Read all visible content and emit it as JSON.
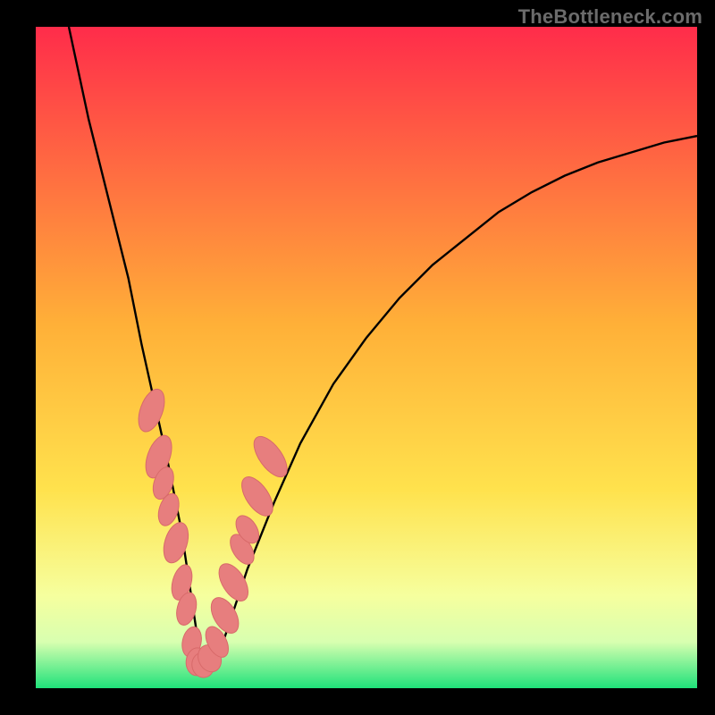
{
  "watermark": "TheBottleneck.com",
  "colors": {
    "frame": "#000000",
    "curve": "#000000",
    "marker_fill": "#e77e7e",
    "marker_stroke": "#d86a6a",
    "gradient_top": "#ff2c4a",
    "gradient_mid": "#ffd23a",
    "gradient_low": "#f6ff9e",
    "gradient_bottom": "#1fe27a"
  },
  "chart_data": {
    "type": "line",
    "title": "",
    "xlabel": "",
    "ylabel": "",
    "xlim": [
      0,
      100
    ],
    "ylim": [
      0,
      100
    ],
    "grid": false,
    "legend": false,
    "series": [
      {
        "name": "curve",
        "x": [
          5,
          8,
          11,
          14,
          16,
          18,
          20,
          22,
          23.5,
          25,
          28,
          32,
          36,
          40,
          45,
          50,
          55,
          60,
          65,
          70,
          75,
          80,
          85,
          90,
          95,
          100
        ],
        "y": [
          100,
          86,
          74,
          62,
          52,
          43,
          34,
          24,
          14,
          4,
          6,
          18,
          28,
          37,
          46,
          53,
          59,
          64,
          68,
          72,
          75,
          77.5,
          79.5,
          81,
          82.5,
          83.5
        ]
      }
    ],
    "markers": [
      {
        "x": 17.5,
        "y": 42,
        "rx": 1.2,
        "ry": 3.2,
        "rot": 20
      },
      {
        "x": 18.6,
        "y": 35,
        "rx": 1.2,
        "ry": 3.2,
        "rot": 20
      },
      {
        "x": 19.3,
        "y": 31,
        "rx": 1.0,
        "ry": 2.4,
        "rot": 18
      },
      {
        "x": 20.1,
        "y": 27,
        "rx": 1.0,
        "ry": 2.4,
        "rot": 18
      },
      {
        "x": 21.2,
        "y": 22,
        "rx": 1.2,
        "ry": 3.0,
        "rot": 17
      },
      {
        "x": 22.1,
        "y": 16,
        "rx": 1.0,
        "ry": 2.6,
        "rot": 15
      },
      {
        "x": 22.8,
        "y": 12,
        "rx": 1.0,
        "ry": 2.4,
        "rot": 14
      },
      {
        "x": 23.6,
        "y": 7,
        "rx": 1.0,
        "ry": 2.2,
        "rot": 12
      },
      {
        "x": 24.4,
        "y": 4,
        "rx": 1.2,
        "ry": 2.0,
        "rot": 5
      },
      {
        "x": 25.3,
        "y": 3.5,
        "rx": 1.2,
        "ry": 1.8,
        "rot": -10
      },
      {
        "x": 26.3,
        "y": 4.5,
        "rx": 1.2,
        "ry": 2.0,
        "rot": -25
      },
      {
        "x": 27.4,
        "y": 7,
        "rx": 1.0,
        "ry": 2.4,
        "rot": -28
      },
      {
        "x": 28.6,
        "y": 11,
        "rx": 1.2,
        "ry": 2.8,
        "rot": -30
      },
      {
        "x": 29.9,
        "y": 16,
        "rx": 1.2,
        "ry": 3.0,
        "rot": -32
      },
      {
        "x": 31.2,
        "y": 21,
        "rx": 1.0,
        "ry": 2.4,
        "rot": -32
      },
      {
        "x": 32.0,
        "y": 24,
        "rx": 1.0,
        "ry": 2.2,
        "rot": -33
      },
      {
        "x": 33.5,
        "y": 29,
        "rx": 1.2,
        "ry": 3.2,
        "rot": -34
      },
      {
        "x": 35.5,
        "y": 35,
        "rx": 1.2,
        "ry": 3.4,
        "rot": -36
      }
    ],
    "notch_x": 25,
    "notes": "Values are estimated in 0–100 normalized axes from pixel positions; y=0 at bottom of plot, x=0 at left."
  }
}
